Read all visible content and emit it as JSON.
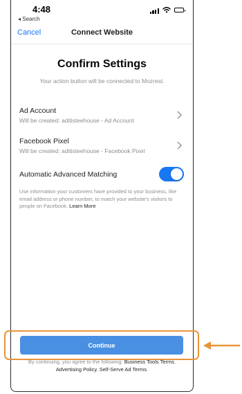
{
  "status_bar": {
    "time": "4:48",
    "back_app": "◂ Search"
  },
  "nav": {
    "cancel": "Cancel",
    "title": "Connect Website"
  },
  "main": {
    "heading": "Confirm Settings",
    "subtitle": "Your action button will be connected to Mozrest.",
    "settings": [
      {
        "label": "Ad Account",
        "sub": "Will be created: aditisteehouse - Ad Account"
      },
      {
        "label": "Facebook Pixel",
        "sub": "Will be created: aditisteehouse - Facebook Pixel"
      }
    ],
    "toggle": {
      "label": "Automatic Advanced Matching",
      "on": true
    },
    "info_text": "Use information your customers have provided to your business, like email address or phone number, to match your website's visitors to people on Facebook.",
    "info_link": "Learn More"
  },
  "continue_button": "Continue",
  "footer": {
    "prefix": "By continuing, you agree to the following: ",
    "link1": "Business Tools Terms",
    "sep": ", ",
    "link2": "Advertising Policy",
    "sep2": ", ",
    "link3": "Self-Serve Ad Terms",
    "suffix": "."
  },
  "colors": {
    "accent": "#1877f2",
    "button": "#4a90e2",
    "highlight": "#e8943a"
  }
}
